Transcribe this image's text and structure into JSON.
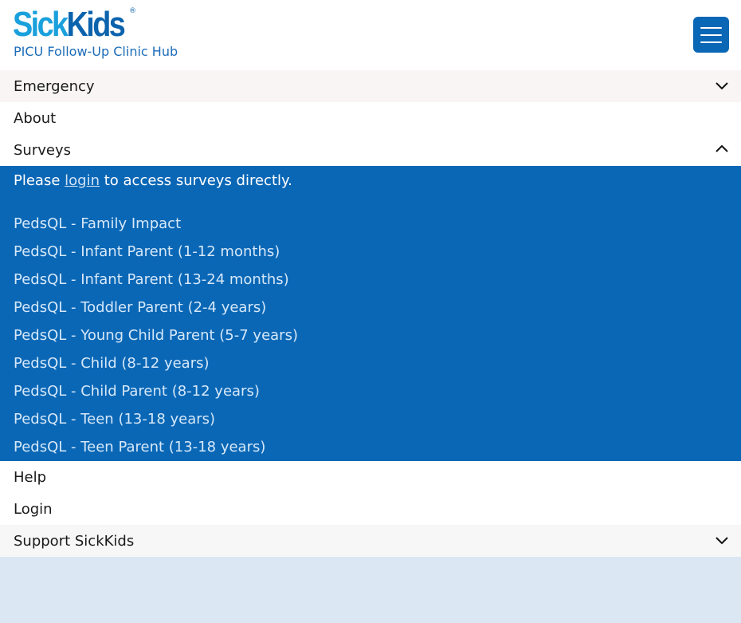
{
  "header": {
    "logo_part1": "Sick",
    "logo_part2": "Kids",
    "logo_reg": "®",
    "subtitle": "PICU Follow-Up Clinic Hub",
    "menu_icon": "hamburger-menu-icon"
  },
  "nav": {
    "emergency": "Emergency",
    "about": "About",
    "surveys": "Surveys",
    "help": "Help",
    "login": "Login",
    "support": "Support SickKids"
  },
  "surveys_panel": {
    "notice_before": "Please ",
    "notice_link": "login",
    "notice_after": " to access surveys directly.",
    "items": [
      "PedsQL - Family Impact",
      "PedsQL - Infant Parent (1-12 months)",
      "PedsQL - Infant Parent (13-24 months)",
      "PedsQL - Toddler Parent (2-4 years)",
      "PedsQL - Young Child Parent (5-7 years)",
      "PedsQL - Child (8-12 years)",
      "PedsQL - Child Parent (8-12 years)",
      "PedsQL - Teen (13-18 years)",
      "PedsQL - Teen Parent (13-18 years)"
    ]
  },
  "colors": {
    "brand_blue": "#0a67b6",
    "logo_light_blue": "#1aa0dc",
    "page_background": "#dbe7f2"
  },
  "icons": {
    "expand": "chevron-down-icon",
    "collapse": "chevron-up-icon"
  }
}
